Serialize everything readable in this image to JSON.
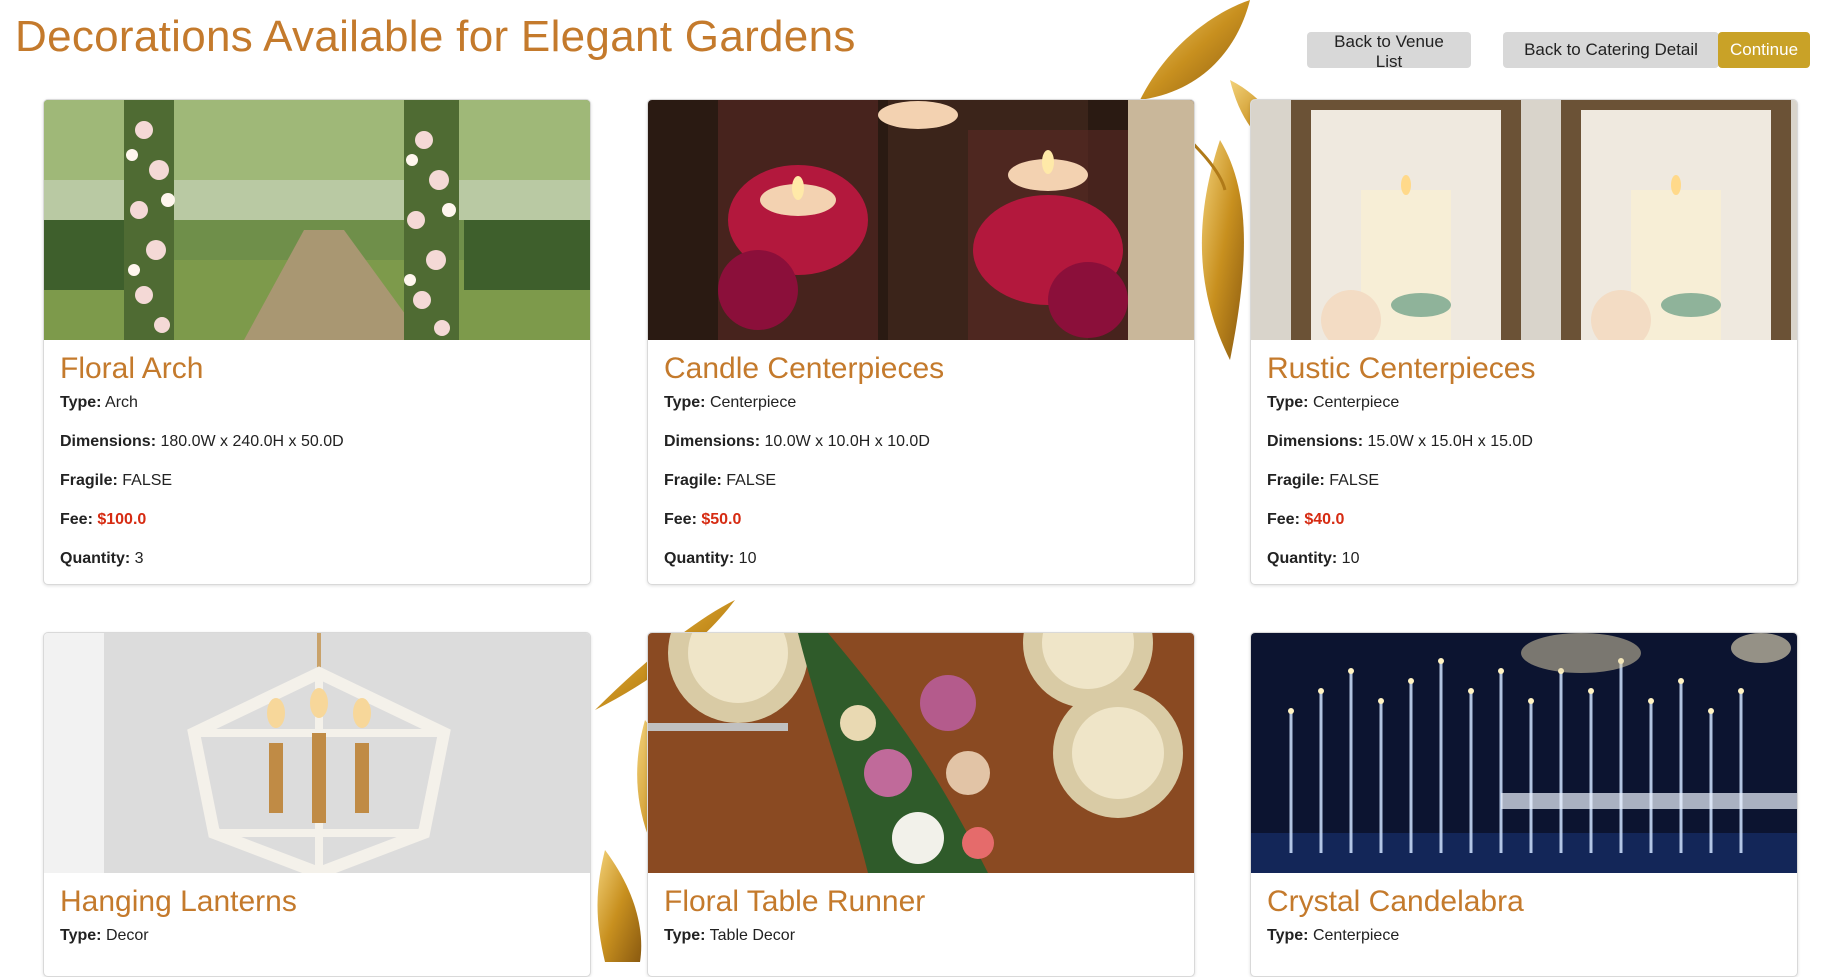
{
  "page": {
    "title": "Decorations Available for Elegant Gardens"
  },
  "buttons": {
    "back_venue": "Back to Venue List",
    "back_catering": "Back to Catering Detail",
    "continue": "Continue"
  },
  "labels": {
    "type": "Type:",
    "dimensions": "Dimensions:",
    "fragile": "Fragile:",
    "fee": "Fee:",
    "quantity": "Quantity:"
  },
  "colors": {
    "title": "#c47a2c",
    "fee": "#d62b12",
    "continue_button": "#c9a227",
    "secondary_button": "#d8d8d8"
  },
  "decorations": [
    {
      "name": "Floral Arch",
      "type": "Arch",
      "dimensions": "180.0W x 240.0H x 50.0D",
      "fragile": "FALSE",
      "fee": "$100.0",
      "quantity": "3"
    },
    {
      "name": "Candle Centerpieces",
      "type": "Centerpiece",
      "dimensions": "10.0W x 10.0H x 10.0D",
      "fragile": "FALSE",
      "fee": "$50.0",
      "quantity": "10"
    },
    {
      "name": "Rustic Centerpieces",
      "type": "Centerpiece",
      "dimensions": "15.0W x 15.0H x 15.0D",
      "fragile": "FALSE",
      "fee": "$40.0",
      "quantity": "10"
    },
    {
      "name": "Hanging Lanterns",
      "type": "Decor"
    },
    {
      "name": "Floral Table Runner",
      "type": "Table Decor"
    },
    {
      "name": "Crystal Candelabra",
      "type": "Centerpiece"
    }
  ]
}
